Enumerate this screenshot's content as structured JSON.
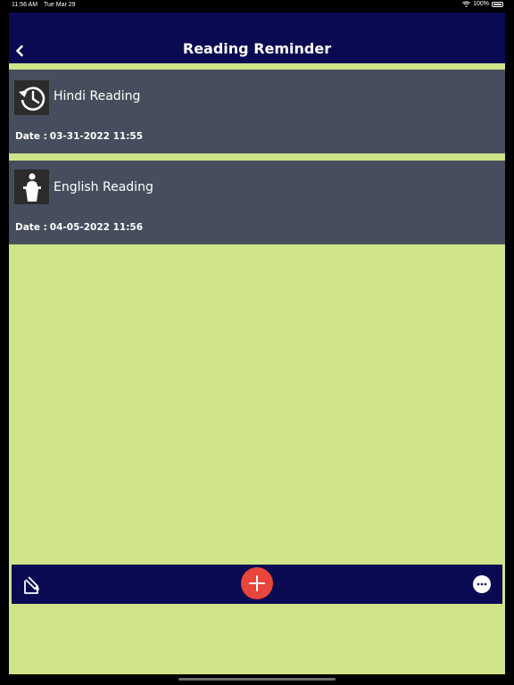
{
  "status_bar": {
    "time": "11:56 AM",
    "date": "Tue Mar 29",
    "battery": "100%",
    "wifi_icon": "wifi-icon",
    "battery_icon": "battery-icon"
  },
  "header": {
    "title": "Reading Reminder",
    "back_icon": "chevron-left-icon"
  },
  "reminders": [
    {
      "title": "Hindi Reading",
      "icon": "history-clock-icon",
      "date_label": "Date :",
      "date_value": "03-31-2022 11:55"
    },
    {
      "title": "English Reading",
      "icon": "podium-speaker-icon",
      "date_label": "Date :",
      "date_value": "04-05-2022 11:56"
    }
  ],
  "toolbar": {
    "edit_icon": "edit-note-icon",
    "add_icon": "plus-icon",
    "more_icon": "more-icon"
  },
  "colors": {
    "navbar": "#090a52",
    "background": "#cfe388",
    "card": "#464e5d",
    "add_button": "#e8453c"
  }
}
